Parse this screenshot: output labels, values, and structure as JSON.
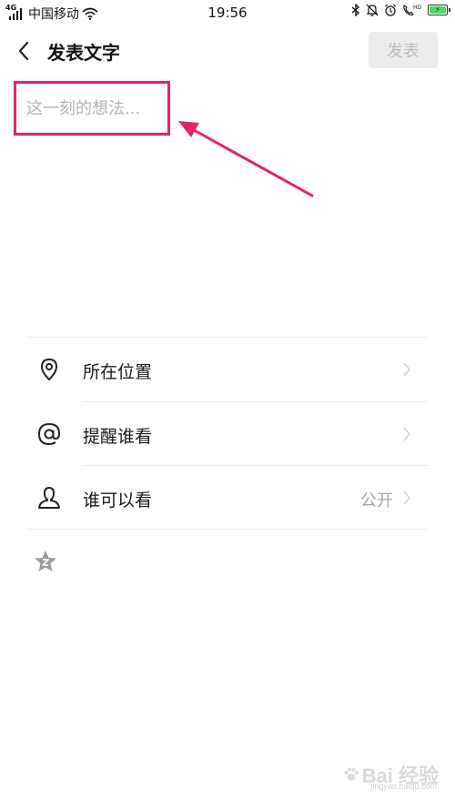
{
  "status_bar": {
    "network_type": "4G",
    "carrier": "中国移动",
    "time": "19:56",
    "battery_charging": true,
    "colors": {
      "battery_fill": "#4cd964"
    }
  },
  "header": {
    "back_icon": "chevron-left-icon",
    "title": "发表文字",
    "publish_label": "发表"
  },
  "composer": {
    "value": "",
    "placeholder": "这一刻的想法..."
  },
  "options": [
    {
      "icon": "location-pin-icon",
      "label": "所在位置",
      "value": ""
    },
    {
      "icon": "at-sign-icon",
      "label": "提醒谁看",
      "value": ""
    },
    {
      "icon": "person-icon",
      "label": "谁可以看",
      "value": "公开"
    }
  ],
  "extra": {
    "icon": "star-icon"
  },
  "annotation": {
    "color": "#e6226a"
  },
  "watermark": {
    "text": "Bai 经验",
    "subtext": "jingyan.baidu.com"
  }
}
